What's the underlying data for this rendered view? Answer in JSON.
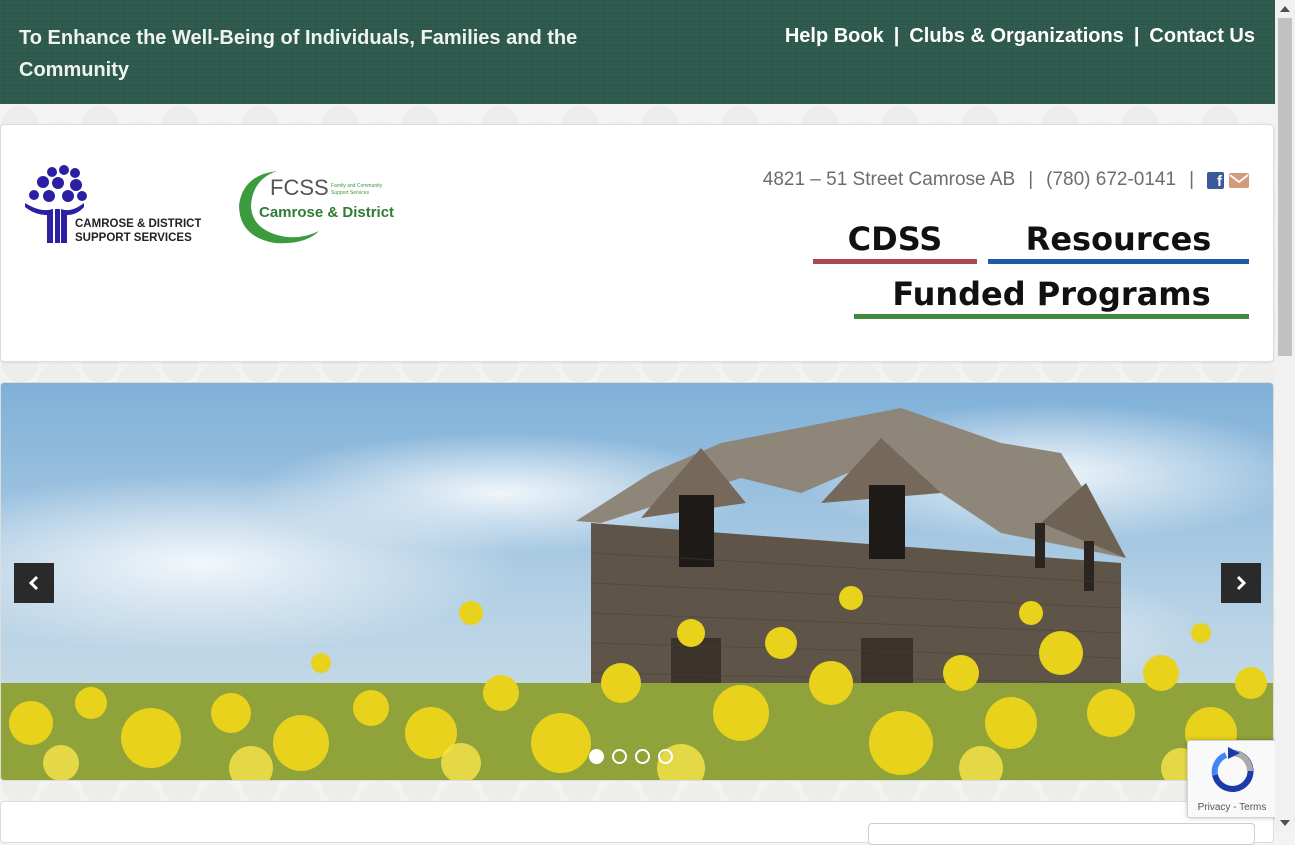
{
  "header": {
    "tagline": "To Enhance the Well-Being of Individuals, Families and the Community",
    "top_links": [
      {
        "label": "Help Book"
      },
      {
        "label": "Clubs & Organizations"
      },
      {
        "label": "Contact Us"
      }
    ],
    "separator": "|"
  },
  "logos": {
    "cdss": {
      "line1": "CAMROSE & DISTRICT",
      "line2": "SUPPORT SERVICES"
    },
    "fcss": {
      "main": "FCSS",
      "small1": "Family and Community",
      "small2": "Support Services",
      "sub": "Camrose & District"
    }
  },
  "contact": {
    "address": "4821 – 51 Street Camrose AB",
    "phone": "(780) 672-0141",
    "icons": [
      "facebook-icon",
      "envelope-icon"
    ]
  },
  "main_nav": [
    {
      "label": "CDSS",
      "color": "#a84b4f"
    },
    {
      "label": "Resources",
      "color": "#1f5aa5"
    },
    {
      "label": "Funded Programs",
      "color": "#3f8a3d"
    }
  ],
  "slider": {
    "slide_count": 4,
    "active_slide": 1,
    "icons": [
      "chevron-left-icon",
      "chevron-right-icon"
    ]
  },
  "recaptcha": {
    "text": "Privacy - Terms"
  },
  "colors": {
    "topbar": "#2f5a4e",
    "accent_red": "#a84b4f",
    "accent_blue": "#1f5aa5",
    "accent_green": "#3f8a3d"
  }
}
